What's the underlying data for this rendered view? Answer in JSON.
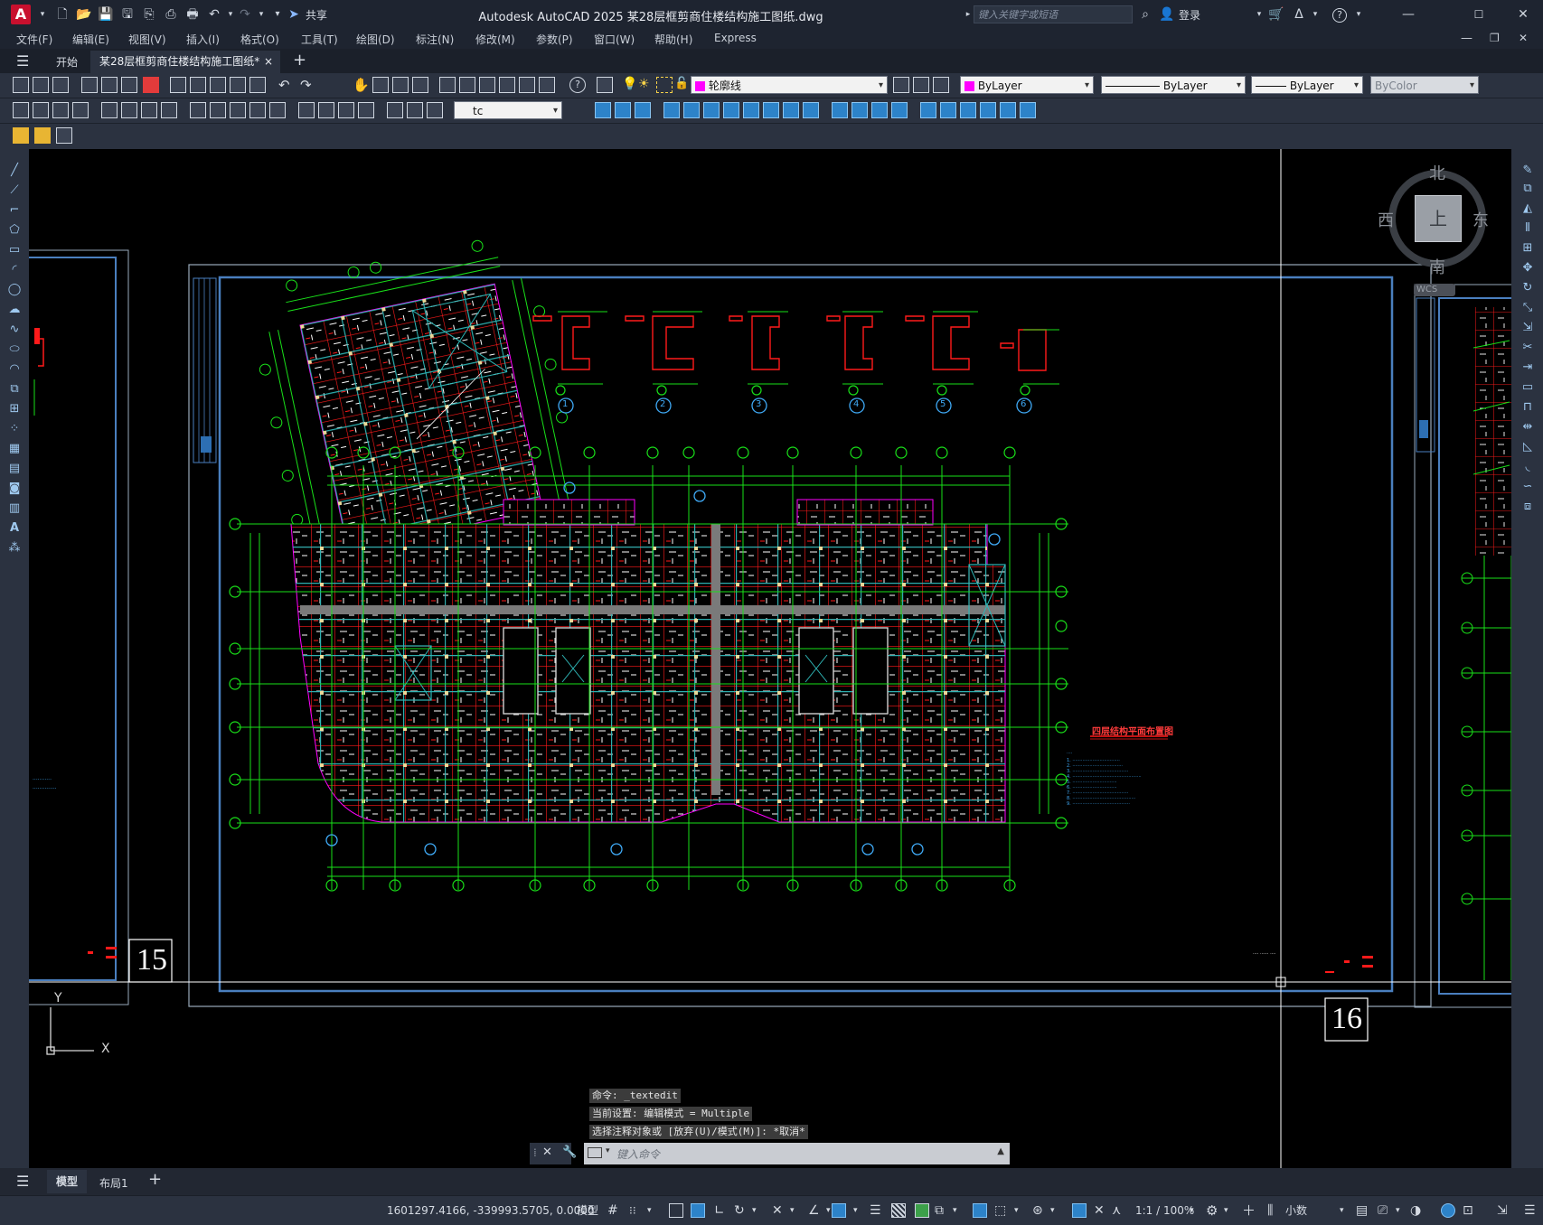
{
  "titlebar": {
    "app_logo": "A",
    "share_label": "共享",
    "title": "Autodesk AutoCAD 2025    某28层框剪商住楼结构施工图纸.dwg",
    "search_placeholder": "键入关键字或短语",
    "login_label": "登录"
  },
  "menu": [
    "文件(F)",
    "编辑(E)",
    "视图(V)",
    "插入(I)",
    "格式(O)",
    "工具(T)",
    "绘图(D)",
    "标注(N)",
    "修改(M)",
    "参数(P)",
    "窗口(W)",
    "帮助(H)",
    "Express"
  ],
  "tabs": {
    "start": "开始",
    "document": "某28层框剪商住楼结构施工图纸*",
    "close": "×",
    "add": "+"
  },
  "toolbar": {
    "layer_name": "轮廓线",
    "color": "ByLayer",
    "linetype": "ByLayer",
    "lineweight": "ByLayer",
    "plotstyle": "ByColor",
    "textstyle": "tc"
  },
  "viewcube": {
    "north": "北",
    "south": "南",
    "east": "东",
    "west": "西",
    "face": "上",
    "wcs": "WCS"
  },
  "drawing": {
    "sheet_left_number": "15",
    "sheet_right_number": "16",
    "plan_title": "四层结构平面布置图",
    "section_labels": [
      "1",
      "2",
      "3",
      "4",
      "5",
      "6"
    ],
    "ucs_x": "X",
    "ucs_y": "Y"
  },
  "command": {
    "lines": [
      "命令: _textedit",
      "当前设置: 编辑模式 = Multiple",
      "选择注释对象或 [放弃(U)/模式(M)]: *取消*"
    ],
    "placeholder": "键入命令"
  },
  "layout_tabs": [
    "模型",
    "布局1"
  ],
  "statusbar": {
    "coords": "1601297.4166, -339993.5705, 0.0000",
    "mode": "模型",
    "scale": "1:1 / 100%",
    "units": "小数"
  },
  "colors": {
    "background": "#000000",
    "grid_green": "#19e019",
    "beam_cyan": "#2fb7b7",
    "rebar_red": "#ff1a1a",
    "accent": "#2d83c9"
  }
}
